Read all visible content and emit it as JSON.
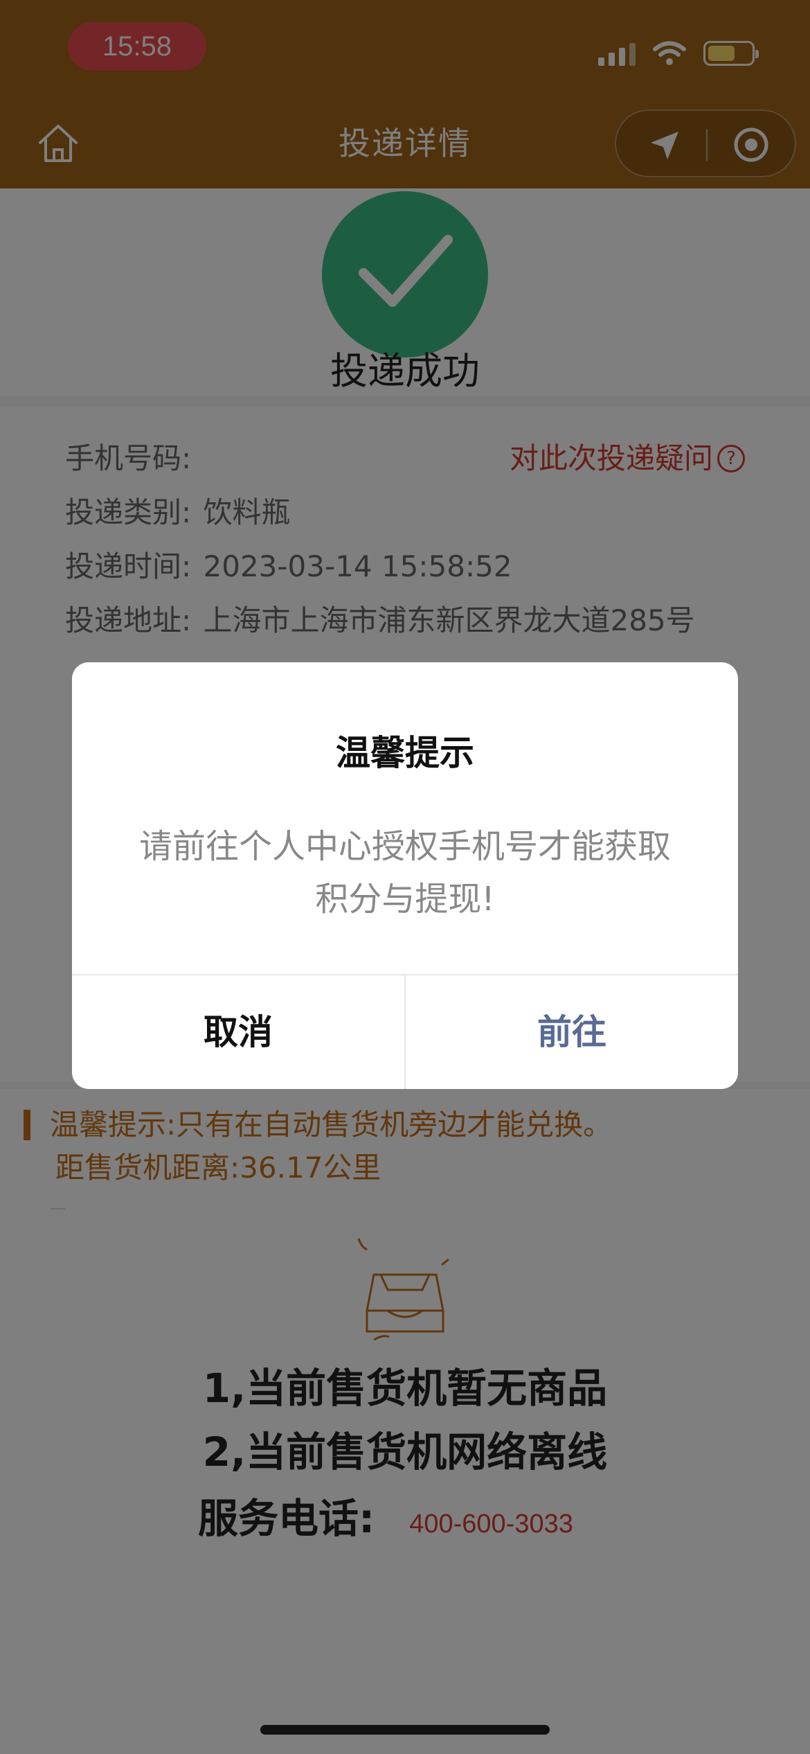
{
  "status_bar": {
    "time": "15:58"
  },
  "nav": {
    "title": "投递详情",
    "home_icon": "home-icon",
    "location_icon": "location-arrow-icon",
    "close_icon": "target-circle-icon"
  },
  "success": {
    "icon": "checkmark-icon",
    "text": "投递成功"
  },
  "info": {
    "phone_label": "手机号码:",
    "phone_value": "",
    "question_link": "对此次投递疑问",
    "question_icon": "?",
    "category_label": "投递类别:",
    "category_value": "饮料瓶",
    "time_label": "投递时间:",
    "time_value": "2023-03-14 15:58:52",
    "address_label": "投递地址:",
    "address_value": "上海市上海市浦东新区界龙大道285号"
  },
  "tip": {
    "line1": "温馨提示:只有在自动售货机旁边才能兑换。",
    "line2": "距售货机距离:36.17公里",
    "empty_icon": "empty-box-icon"
  },
  "notices": {
    "line1": "1,当前售货机暂无商品",
    "line2": "2,当前售货机网络离线",
    "service_label": "服务电话:",
    "service_phone": "400-600-3033"
  },
  "dialog": {
    "title": "温馨提示",
    "message": "请前往个人中心授权手机号才能获取积分与提现!",
    "cancel": "取消",
    "confirm": "前往"
  },
  "colors": {
    "header": "#a06418",
    "success_green": "#3bbd86",
    "tip_orange": "#c46f1b",
    "alert_red": "#d23a30",
    "dialog_confirm": "#576b95"
  }
}
